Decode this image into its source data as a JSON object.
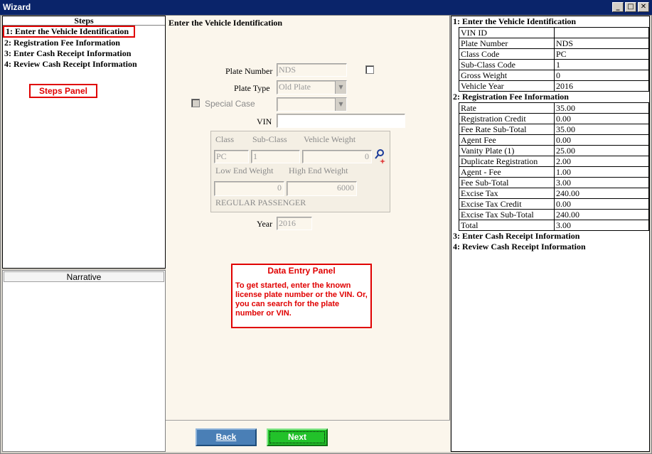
{
  "window": {
    "title": "Wizard"
  },
  "steps": {
    "header": "Steps",
    "items": [
      "1: Enter the Vehicle Identification",
      "2: Registration Fee Information",
      "3: Enter Cash Receipt Information",
      "4: Review Cash Receipt Information"
    ],
    "annotation": "Steps Panel"
  },
  "narrative": {
    "header": "Narrative"
  },
  "form": {
    "title": "Enter the Vehicle Identification",
    "plate_number_label": "Plate Number",
    "plate_number_value": "NDS",
    "plate_type_label": "Plate Type",
    "plate_type_value": "Old Plate",
    "special_case_label": "Special Case",
    "special_case_value": "",
    "vin_label": "VIN",
    "vin_value": "",
    "class_label": "Class",
    "subclass_label": "Sub-Class",
    "vehicle_weight_label": "Vehicle  Weight",
    "class_value": "PC",
    "subclass_value": "1",
    "vehicle_weight_value": "0",
    "low_end_label": "Low End Weight",
    "high_end_label": "High End Weight",
    "low_end_value": "0",
    "high_end_value": "6000",
    "class_description": "REGULAR PASSENGER",
    "year_label": "Year",
    "year_value": "2016",
    "annotation_title": "Data Entry Panel",
    "annotation_text": "To get started, enter the known license plate number or the VIN. Or, you can search for the plate number or VIN.",
    "back_label": "Back",
    "next_label": "Next"
  },
  "summary": {
    "sections": [
      {
        "title": "1: Enter the Vehicle Identification",
        "rows": [
          [
            "VIN ID",
            ""
          ],
          [
            "Plate Number",
            "NDS"
          ],
          [
            "Class Code",
            "PC"
          ],
          [
            "Sub-Class Code",
            "1"
          ],
          [
            "Gross Weight",
            "0"
          ],
          [
            "Vehicle Year",
            "2016"
          ]
        ]
      },
      {
        "title": "2: Registration Fee Information",
        "rows": [
          [
            "Rate",
            "35.00"
          ],
          [
            "Registration Credit",
            "0.00"
          ],
          [
            "Fee Rate Sub-Total",
            "35.00"
          ],
          [
            "Agent Fee",
            "0.00"
          ],
          [
            "Vanity Plate (1)",
            "25.00"
          ],
          [
            "Duplicate Registration",
            "2.00"
          ],
          [
            "Agent - Fee",
            "1.00"
          ],
          [
            "Fee Sub-Total",
            "3.00"
          ],
          [
            "Excise Tax",
            "240.00"
          ],
          [
            "Excise Tax Credit",
            "0.00"
          ],
          [
            "Excise Tax Sub-Total",
            "240.00"
          ],
          [
            "Total",
            "3.00"
          ]
        ]
      },
      {
        "title": "3: Enter Cash Receipt Information",
        "rows": []
      },
      {
        "title": "4: Review Cash Receipt Information",
        "rows": []
      }
    ]
  },
  "colors": {
    "titlebar": "#0a246a",
    "annotation": "#e00000",
    "next": "#22c22a",
    "back": "#4a7fb6"
  }
}
